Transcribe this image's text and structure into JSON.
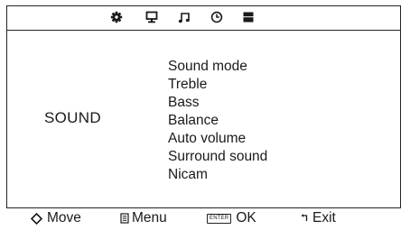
{
  "icon_bar": {
    "icons": [
      "gear-icon",
      "monitor-icon",
      "music-note-icon",
      "clock-icon",
      "channel-list-icon"
    ]
  },
  "section": {
    "title": "SOUND"
  },
  "menu": {
    "items": [
      {
        "label": "Sound mode"
      },
      {
        "label": "Treble"
      },
      {
        "label": "Bass"
      },
      {
        "label": "Balance"
      },
      {
        "label": "Auto volume"
      },
      {
        "label": "Surround sound"
      },
      {
        "label": "Nicam"
      }
    ]
  },
  "footer": {
    "move_label": "Move",
    "menu_label": "Menu",
    "enter_key_label": "ENTER",
    "ok_label": "OK",
    "exit_label": "Exit"
  }
}
